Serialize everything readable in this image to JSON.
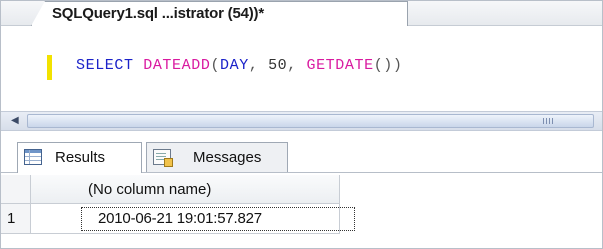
{
  "document_tab": {
    "title": "SQLQuery1.sql ...istrator (54))*"
  },
  "editor": {
    "tokens": {
      "select": "SELECT",
      "dateadd": "DATEADD",
      "open1": "(",
      "day": "DAY",
      "comma1": ", ",
      "fifty": "50",
      "comma2": ", ",
      "getdate": "GETDATE",
      "parens": "()",
      "close1": ")"
    }
  },
  "results_tabs": [
    {
      "label": "Results",
      "icon": "grid-icon",
      "active": true
    },
    {
      "label": "Messages",
      "icon": "messages-icon",
      "active": false
    }
  ],
  "grid": {
    "columns": [
      "(No column name)"
    ],
    "rows": [
      {
        "num": "1",
        "cells": [
          "2010-06-21 19:01:57.827"
        ]
      }
    ]
  },
  "colors": {
    "keyword": "#1b22c9",
    "function": "#d91aa0",
    "change_marker": "#f2e200"
  }
}
